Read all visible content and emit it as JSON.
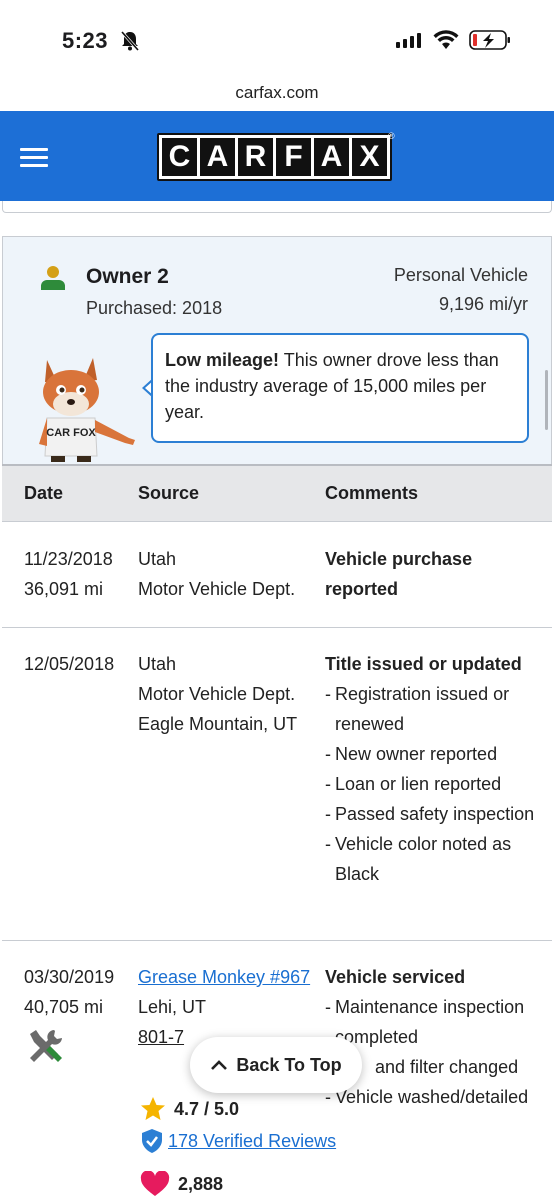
{
  "status_bar": {
    "time": "5:23"
  },
  "browser": {
    "url": "carfax.com"
  },
  "header": {
    "logo_letters": [
      "C",
      "A",
      "R",
      "F",
      "A",
      "X"
    ],
    "registered_mark": "®",
    "brand_color": "#1d6fd6"
  },
  "owner": {
    "title": "Owner 2",
    "purchased": "Purchased: 2018",
    "vehicle_type": "Personal Vehicle",
    "miles_per_year": "9,196 mi/yr",
    "callout_bold": "Low mileage!",
    "callout_text": " This owner drove less than the industry average of 15,000 miles per year.",
    "mascot_shirt": "CAR FOX"
  },
  "table": {
    "headers": {
      "date": "Date",
      "source": "Source",
      "comments": "Comments"
    },
    "rows": [
      {
        "date": "11/23/2018",
        "mileage": "36,091 mi",
        "source_lines": [
          "Utah",
          "Motor Vehicle Dept."
        ],
        "comment_title": "Vehicle purchase reported",
        "comments": []
      },
      {
        "date": "12/05/2018",
        "mileage": "",
        "source_lines": [
          "Utah",
          "Motor Vehicle Dept.",
          "Eagle Mountain, UT"
        ],
        "comment_title": "Title issued or updated",
        "comments": [
          "Registration issued or renewed",
          "New owner reported",
          "Loan or lien reported",
          "Passed safety inspection",
          "Vehicle color noted as Black"
        ]
      },
      {
        "date": "03/30/2019",
        "mileage": "40,705 mi",
        "source_link": "Grease Monkey #967",
        "source_lines": [
          "Lehi, UT",
          "801-7"
        ],
        "comment_title": "Vehicle serviced",
        "comments": [
          "Maintenance inspection completed",
          "and filter changed",
          "Vehicle washed/detailed"
        ],
        "rating": "4.7 / 5.0",
        "reviews": "178 Verified Reviews",
        "favorites": "2,888"
      }
    ]
  },
  "back_to_top": "Back To Top"
}
